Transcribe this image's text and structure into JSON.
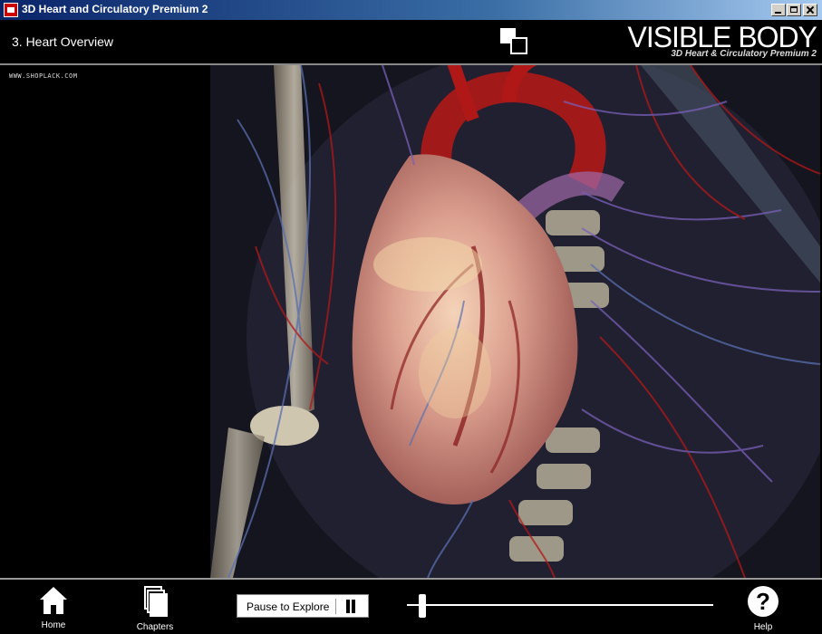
{
  "window": {
    "title": "3D Heart and Circulatory Premium 2"
  },
  "header": {
    "chapter_title": "3. Heart Overview",
    "logo_brand": "VISIBLE BODY",
    "logo_sub": "3D Heart & Circulatory Premium 2"
  },
  "viewport": {
    "watermark": "WWW.SHOPLACK.COM"
  },
  "toolbar": {
    "home_label": "Home",
    "chapters_label": "Chapters",
    "pause_label": "Pause to Explore",
    "help_label": "Help",
    "timeline_progress": 0.05
  },
  "colors": {
    "accent_red": "#b01818",
    "vein_blue": "#5a6fb0",
    "heart_pink": "#d89a8e"
  }
}
